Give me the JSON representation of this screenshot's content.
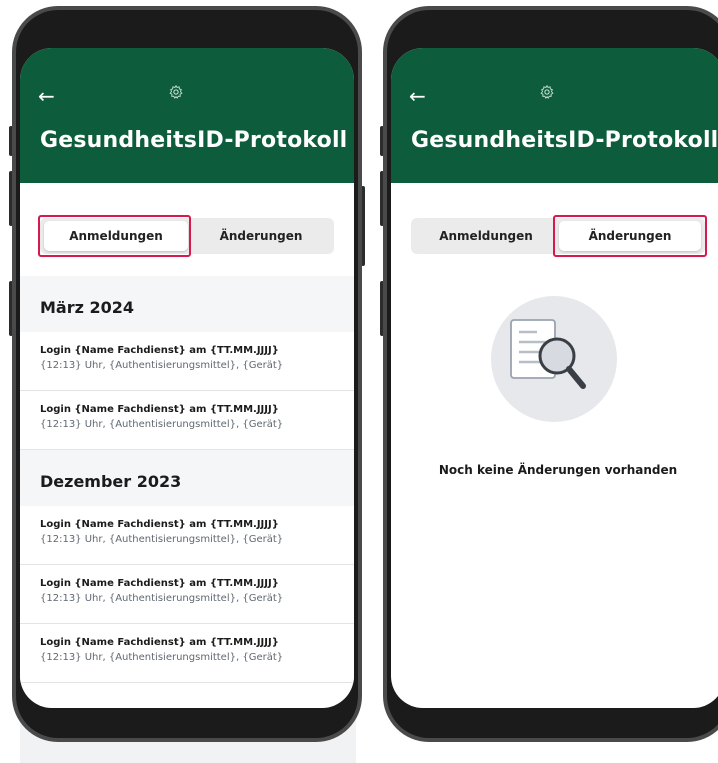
{
  "left": {
    "title": "GesundheitsID-Protokoll",
    "tabs": [
      "Anmeldungen",
      "Änderungen"
    ],
    "active_tab": "Anmeldungen",
    "sections": [
      {
        "month": "März 2024",
        "entries": [
          {
            "line1": "Login {Name Fachdienst} am {TT.MM.JJJJ}",
            "line2": "{12:13} Uhr, {Authentisierungsmittel}, {Gerät}"
          },
          {
            "line1": "Login {Name Fachdienst} am {TT.MM.JJJJ}",
            "line2": "{12:13} Uhr, {Authentisierungsmittel}, {Gerät}"
          }
        ]
      },
      {
        "month": "Dezember 2023",
        "entries": [
          {
            "line1": "Login {Name Fachdienst} am {TT.MM.JJJJ}",
            "line2": "{12:13} Uhr, {Authentisierungsmittel}, {Gerät}"
          },
          {
            "line1": "Login {Name Fachdienst} am {TT.MM.JJJJ}",
            "line2": "{12:13} Uhr, {Authentisierungsmittel}, {Gerät}"
          },
          {
            "line1": "Login {Name Fachdienst} am {TT.MM.JJJJ}",
            "line2": "{12:13} Uhr, {Authentisierungsmittel}, {Gerät}"
          }
        ]
      }
    ]
  },
  "right": {
    "title": "GesundheitsID-Protokoll",
    "tabs": [
      "Anmeldungen",
      "Änderungen"
    ],
    "active_tab": "Änderungen",
    "empty_message": "Noch keine Änderungen vorhanden"
  },
  "colors": {
    "header": "#0d5d3c",
    "highlight": "#d61a4e"
  }
}
